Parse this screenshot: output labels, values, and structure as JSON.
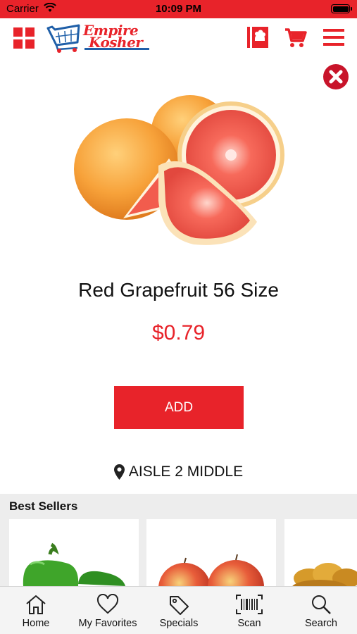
{
  "status_bar": {
    "carrier": "Carrier",
    "time": "10:09 PM"
  },
  "header": {
    "logo_line1": "Empire",
    "logo_line2": "Kosher",
    "icons": [
      "grid-menu-icon",
      "store-card-icon",
      "cart-icon",
      "hamburger-menu-icon"
    ]
  },
  "product": {
    "name": "Red Grapefruit 56 Size",
    "price": "$0.79",
    "add_label": "ADD",
    "aisle": "AISLE 2 MIDDLE"
  },
  "best_sellers": {
    "title": "Best Sellers",
    "items": [
      "green-peppers-image",
      "apples-image",
      "challah-bread-image"
    ]
  },
  "tab_bar": {
    "tabs": [
      {
        "label": "Home",
        "icon": "home-icon"
      },
      {
        "label": "My Favorites",
        "icon": "heart-icon"
      },
      {
        "label": "Specials",
        "icon": "tag-icon"
      },
      {
        "label": "Scan",
        "icon": "barcode-icon"
      },
      {
        "label": "Search",
        "icon": "search-icon"
      }
    ]
  },
  "colors": {
    "brand_red": "#e8232a",
    "brand_blue": "#1f5fa8",
    "close_red": "#c8142a",
    "tab_bar_bg": "#f4f4f4"
  }
}
